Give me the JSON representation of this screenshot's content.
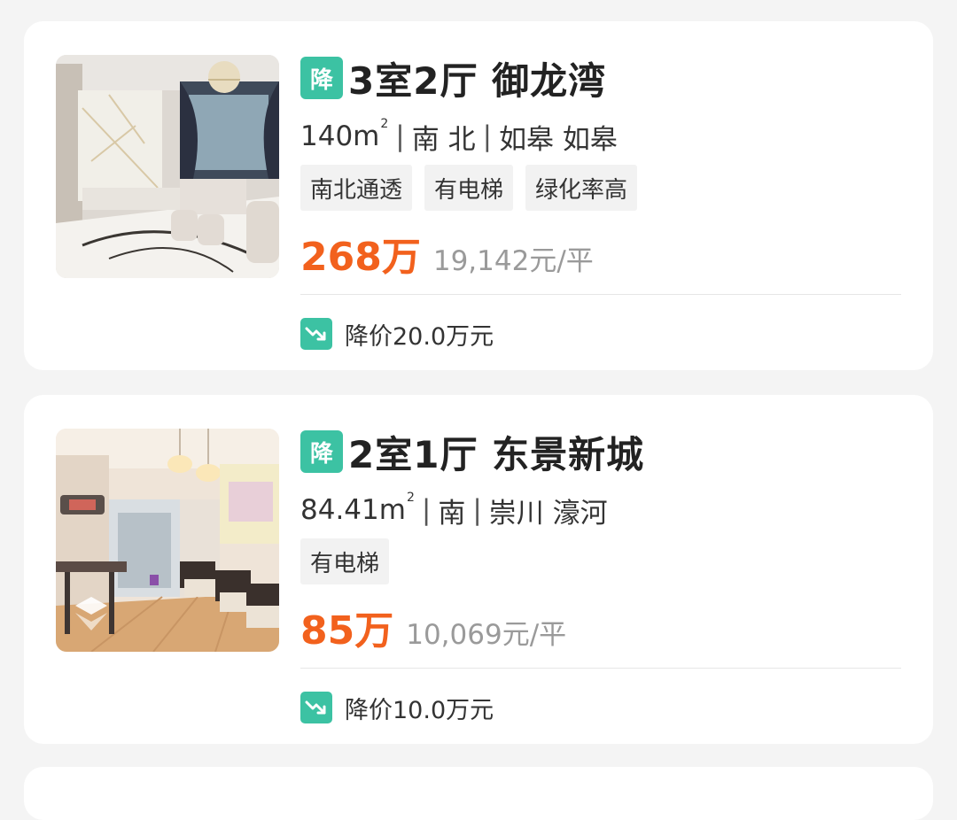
{
  "listings": [
    {
      "badge": "降",
      "title": "3室2厅 御龙湾",
      "area": "140m",
      "area_unit": "2",
      "orientation": "南 北",
      "district": "如皋 如皋",
      "tags": [
        "南北通透",
        "有电梯",
        "绿化率高"
      ],
      "price": "268万",
      "unit_price": "19,142元/平",
      "price_drop": "降价20.0万元"
    },
    {
      "badge": "降",
      "title": "2室1厅 东景新城",
      "area": "84.41m",
      "area_unit": "2",
      "orientation": "南",
      "district": "崇川 濠河",
      "tags": [
        "有电梯"
      ],
      "price": "85万",
      "unit_price": "10,069元/平",
      "price_drop": "降价10.0万元"
    }
  ],
  "colors": {
    "accent_green": "#3cc2a3",
    "price_orange": "#f2611d",
    "background": "#f4f4f4"
  },
  "icons": {
    "badge": "price-drop-badge",
    "drop": "trend-down-icon"
  }
}
